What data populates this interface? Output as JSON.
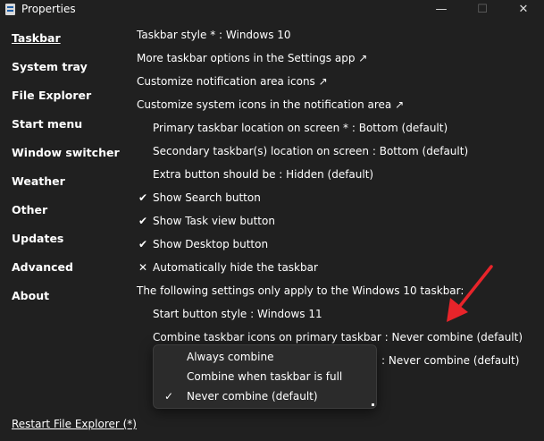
{
  "window": {
    "title": "Properties",
    "minimize": "—",
    "maximize": "☐",
    "close": "✕"
  },
  "sidebar": {
    "items": [
      {
        "label": "Taskbar",
        "active": true
      },
      {
        "label": "System tray"
      },
      {
        "label": "File Explorer"
      },
      {
        "label": "Start menu"
      },
      {
        "label": "Window switcher"
      },
      {
        "label": "Weather"
      },
      {
        "label": "Other"
      },
      {
        "label": "Updates"
      },
      {
        "label": "Advanced"
      },
      {
        "label": "About"
      }
    ],
    "restart_label": "Restart File Explorer (*)"
  },
  "settings": {
    "taskbar_style": "Taskbar style * : Windows 10",
    "more_options": "More taskbar options in the Settings app ↗",
    "notif_icons": "Customize notification area icons ↗",
    "system_icons": "Customize system icons in the notification area ↗",
    "primary_location": "Primary taskbar location on screen * : Bottom (default)",
    "secondary_location": "Secondary taskbar(s) location on screen : Bottom (default)",
    "extra_button": "Extra button should be : Hidden (default)",
    "show_search": {
      "label": "Show Search button",
      "mark": "✔"
    },
    "show_taskview": {
      "label": "Show Task view button",
      "mark": "✔"
    },
    "show_desktop": {
      "label": "Show Desktop button",
      "mark": "✔"
    },
    "auto_hide": {
      "label": "Automatically hide the taskbar",
      "mark": "✕"
    },
    "win10_note": "The following settings only apply to the Windows 10 taskbar:",
    "start_button_style": "Start button style : Windows 11",
    "combine_primary": "Combine taskbar icons on primary taskbar : Never combine (default)",
    "combine_secondary_tail": ": Never combine (default)"
  },
  "dropdown": {
    "options": [
      {
        "label": "Always combine",
        "check": ""
      },
      {
        "label": "Combine when taskbar is full",
        "check": ""
      },
      {
        "label": "Never combine (default)",
        "check": "✓"
      }
    ]
  },
  "colors": {
    "background": "#202020",
    "text": "#ffffff",
    "annotation_arrow": "#e8242a"
  },
  "icons": {
    "app": "document-icon",
    "annotation": "red-arrow-icon"
  }
}
